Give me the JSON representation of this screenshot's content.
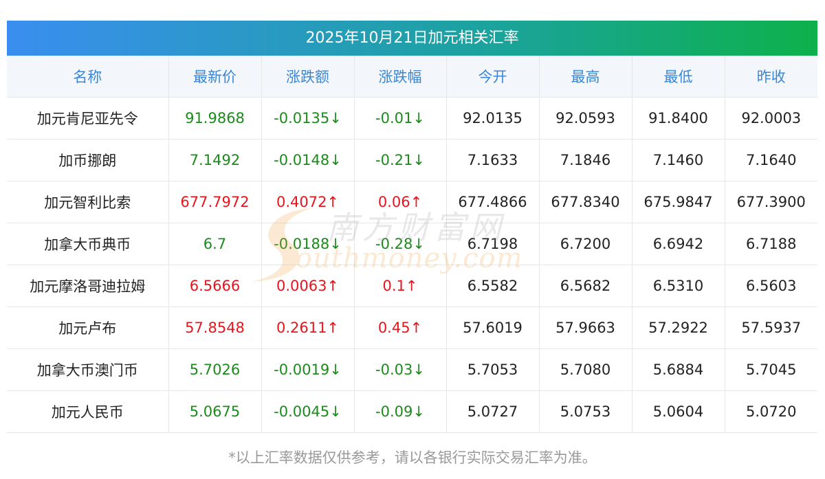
{
  "title": "2025年10月21日加元相关汇率",
  "columns": [
    "名称",
    "最新价",
    "涨跌额",
    "涨跌幅",
    "今开",
    "最高",
    "最低",
    "昨收"
  ],
  "rows": [
    {
      "name": "加元肯尼亚先令",
      "latest": "91.9868",
      "change": "-0.0135↓",
      "pct": "-0.01↓",
      "open": "92.0135",
      "high": "92.0593",
      "low": "91.8400",
      "prev": "92.0003",
      "dir": "down"
    },
    {
      "name": "加币挪朗",
      "latest": "7.1492",
      "change": "-0.0148↓",
      "pct": "-0.21↓",
      "open": "7.1633",
      "high": "7.1846",
      "low": "7.1460",
      "prev": "7.1640",
      "dir": "down"
    },
    {
      "name": "加元智利比索",
      "latest": "677.7972",
      "change": "0.4072↑",
      "pct": "0.06↑",
      "open": "677.4866",
      "high": "677.8340",
      "low": "675.9847",
      "prev": "677.3900",
      "dir": "up"
    },
    {
      "name": "加拿大币典币",
      "latest": "6.7",
      "change": "-0.0188↓",
      "pct": "-0.28↓",
      "open": "6.7198",
      "high": "6.7200",
      "low": "6.6942",
      "prev": "6.7188",
      "dir": "down"
    },
    {
      "name": "加元摩洛哥迪拉姆",
      "latest": "6.5666",
      "change": "0.0063↑",
      "pct": "0.1↑",
      "open": "6.5582",
      "high": "6.5682",
      "low": "6.5310",
      "prev": "6.5603",
      "dir": "up"
    },
    {
      "name": "加元卢布",
      "latest": "57.8548",
      "change": "0.2611↑",
      "pct": "0.45↑",
      "open": "57.6019",
      "high": "57.9663",
      "low": "57.2922",
      "prev": "57.5937",
      "dir": "up"
    },
    {
      "name": "加拿大币澳门币",
      "latest": "5.7026",
      "change": "-0.0019↓",
      "pct": "-0.03↓",
      "open": "5.7053",
      "high": "5.7080",
      "low": "5.6884",
      "prev": "5.7045",
      "dir": "down"
    },
    {
      "name": "加元人民币",
      "latest": "5.0675",
      "change": "-0.0045↓",
      "pct": "-0.09↓",
      "open": "5.0727",
      "high": "5.0753",
      "low": "5.0604",
      "prev": "5.0720",
      "dir": "down"
    }
  ],
  "footnote": "*以上汇率数据仅供参考，请以各银行实际交易汇率为准。",
  "watermark": {
    "cn": "南方财富网",
    "en": "outhmoney.com"
  },
  "colors": {
    "up": "#e8141c",
    "down": "#1b8a1b",
    "header_text": "#3a86d4",
    "header_bg": "#f3f7fc",
    "gradient_start": "#3a8ef0",
    "gradient_end": "#0db14b"
  }
}
